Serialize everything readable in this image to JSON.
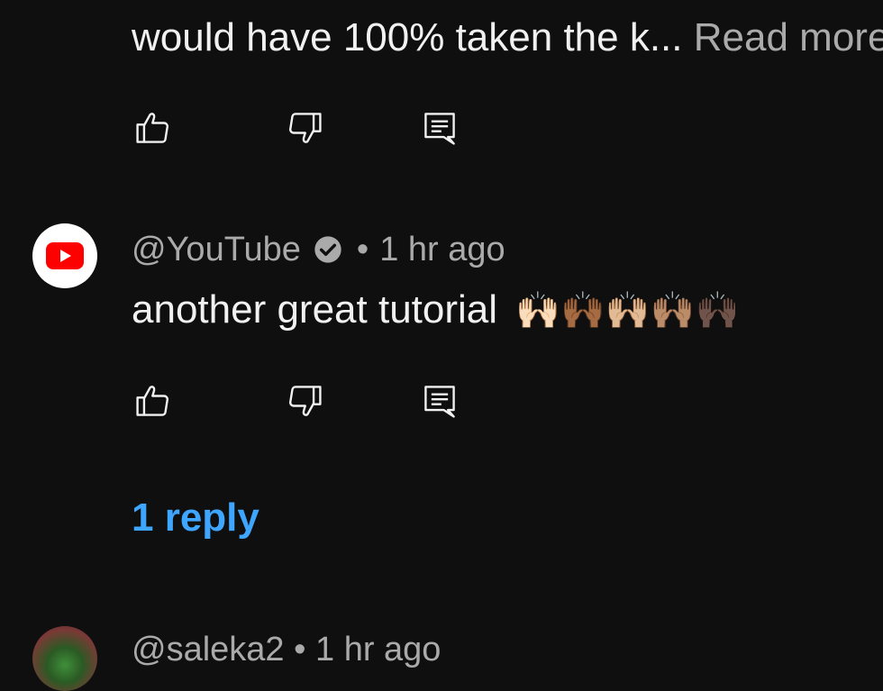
{
  "previous_comment": {
    "text": "would have 100% taken the k...",
    "read_more_label": "Read more"
  },
  "comment": {
    "author": "@YouTube",
    "verified_icon": "verified-check-icon",
    "separator": "•",
    "time": "1 hr ago",
    "text": "another great tutorial",
    "emojis": "🙌🏻🙌🏾🙌🏼🙌🏽🙌🏿",
    "replies_label": "1 reply"
  },
  "next_comment": {
    "author": "@saleka2",
    "separator": "•",
    "time": "1 hr ago"
  },
  "icons": {
    "like": "thumbs-up-icon",
    "dislike": "thumbs-down-icon",
    "reply": "reply-icon"
  },
  "colors": {
    "background": "#0f0f0f",
    "text": "#f1f1f1",
    "secondary_text": "#aaaaaa",
    "link": "#3ea6ff",
    "youtube_red": "#ff0000"
  }
}
